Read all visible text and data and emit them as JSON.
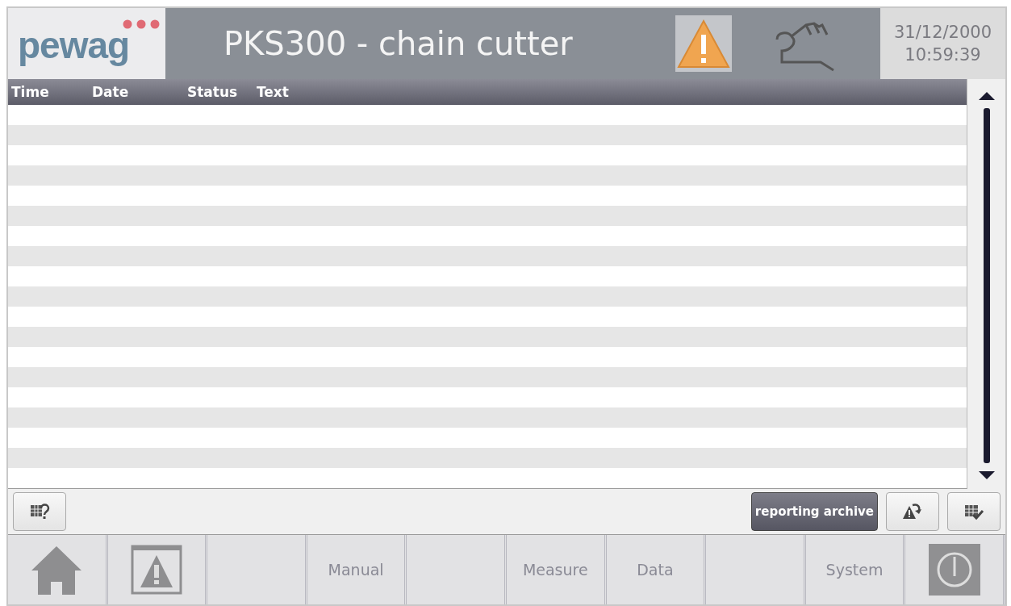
{
  "header": {
    "logo": "pewag",
    "title": "PKS300 - chain cutter",
    "date": "31/12/2000",
    "time": "10:59:39"
  },
  "table": {
    "columns": [
      "Time",
      "Date",
      "Status",
      "Text"
    ]
  },
  "toolbar": {
    "archive_button": "reporting archive"
  },
  "nav": [
    {
      "kind": "home"
    },
    {
      "kind": "alarm"
    },
    {
      "kind": "blank"
    },
    {
      "kind": "text",
      "label": "Manual"
    },
    {
      "kind": "blank"
    },
    {
      "kind": "text",
      "label": "Measure"
    },
    {
      "kind": "text",
      "label": "Data"
    },
    {
      "kind": "blank"
    },
    {
      "kind": "text",
      "label": "System"
    },
    {
      "kind": "power"
    }
  ]
}
